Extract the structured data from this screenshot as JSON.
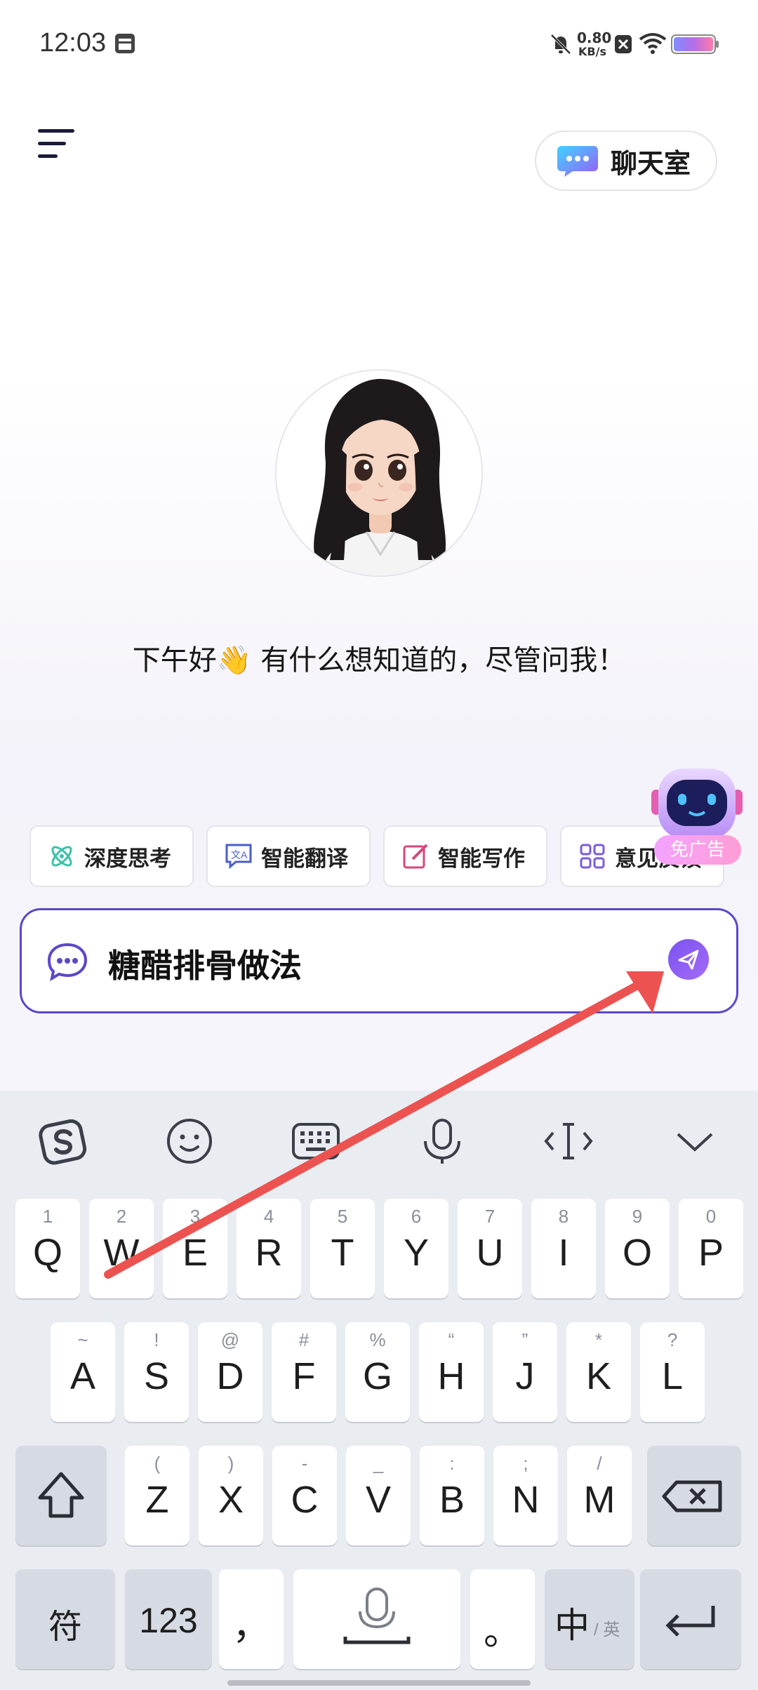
{
  "status_bar": {
    "time": "12:03",
    "network_speed_value": "0.80",
    "network_speed_unit": "KB/s",
    "icons": [
      "notification-icon",
      "mute-icon",
      "sim-blocked-icon",
      "wifi-icon",
      "battery-icon"
    ]
  },
  "header": {
    "chat_room_label": "聊天室"
  },
  "greeting": "下午好👋 有什么想知道的，尽管问我！",
  "robot_badge": "免广告",
  "chips": [
    {
      "label": "深度思考",
      "icon": "atom-icon"
    },
    {
      "label": "智能翻译",
      "icon": "translate-icon"
    },
    {
      "label": "智能写作",
      "icon": "edit-icon"
    },
    {
      "label": "意见反馈",
      "icon": "grid-icon"
    }
  ],
  "input": {
    "value": "糖醋排骨做法"
  },
  "keyboard": {
    "toolbar": [
      "sogou-logo-icon",
      "emoji-icon",
      "keyboard-icon",
      "microphone-icon",
      "cursor-icon",
      "collapse-icon"
    ],
    "row1": [
      {
        "main": "Q",
        "sub": "1"
      },
      {
        "main": "W",
        "sub": "2"
      },
      {
        "main": "E",
        "sub": "3"
      },
      {
        "main": "R",
        "sub": "4"
      },
      {
        "main": "T",
        "sub": "5"
      },
      {
        "main": "Y",
        "sub": "6"
      },
      {
        "main": "U",
        "sub": "7"
      },
      {
        "main": "I",
        "sub": "8"
      },
      {
        "main": "O",
        "sub": "9"
      },
      {
        "main": "P",
        "sub": "0"
      }
    ],
    "row2": [
      {
        "main": "A",
        "sub": "~"
      },
      {
        "main": "S",
        "sub": "!"
      },
      {
        "main": "D",
        "sub": "@"
      },
      {
        "main": "F",
        "sub": "#"
      },
      {
        "main": "G",
        "sub": "%"
      },
      {
        "main": "H",
        "sub": "“"
      },
      {
        "main": "J",
        "sub": "”"
      },
      {
        "main": "K",
        "sub": "*"
      },
      {
        "main": "L",
        "sub": "?"
      }
    ],
    "row3": [
      {
        "main": "Z",
        "sub": "("
      },
      {
        "main": "X",
        "sub": ")"
      },
      {
        "main": "C",
        "sub": "-"
      },
      {
        "main": "V",
        "sub": "_"
      },
      {
        "main": "B",
        "sub": ":"
      },
      {
        "main": "N",
        "sub": ";"
      },
      {
        "main": "M",
        "sub": "/"
      }
    ],
    "symbols_key": "符",
    "numbers_key": "123",
    "comma_key": "，",
    "period_key": "。",
    "lang_key_main": "中",
    "lang_key_sub": "/ 英"
  }
}
